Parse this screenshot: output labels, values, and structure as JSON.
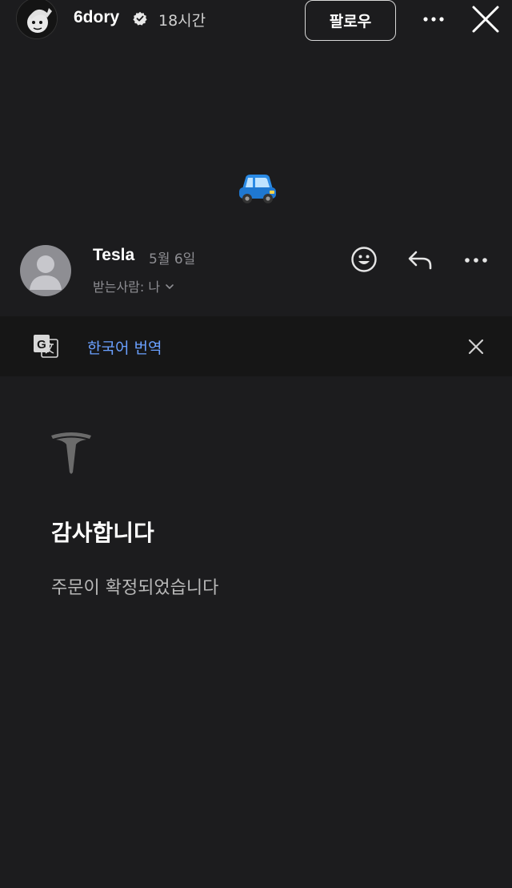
{
  "header": {
    "username": "6dory",
    "time": "18시간",
    "follow_label": "팔로우"
  },
  "email": {
    "sender": "Tesla",
    "date": "5월 6일",
    "recipient": "받는사람: 나"
  },
  "translate": {
    "label": "한국어 번역"
  },
  "body": {
    "title": "감사합니다",
    "message": "주문이 확정되었습니다"
  },
  "colors": {
    "background": "#1c1c1e",
    "translate_bar": "#161616",
    "link_blue": "#6aa0ff",
    "secondary_text": "#8e8e93"
  },
  "icons": [
    "verified-badge-icon",
    "more-icon",
    "close-icon",
    "car-emoji-icon",
    "person-avatar-icon",
    "emoji-react-icon",
    "reply-icon",
    "translate-icon",
    "tesla-logo-icon"
  ]
}
